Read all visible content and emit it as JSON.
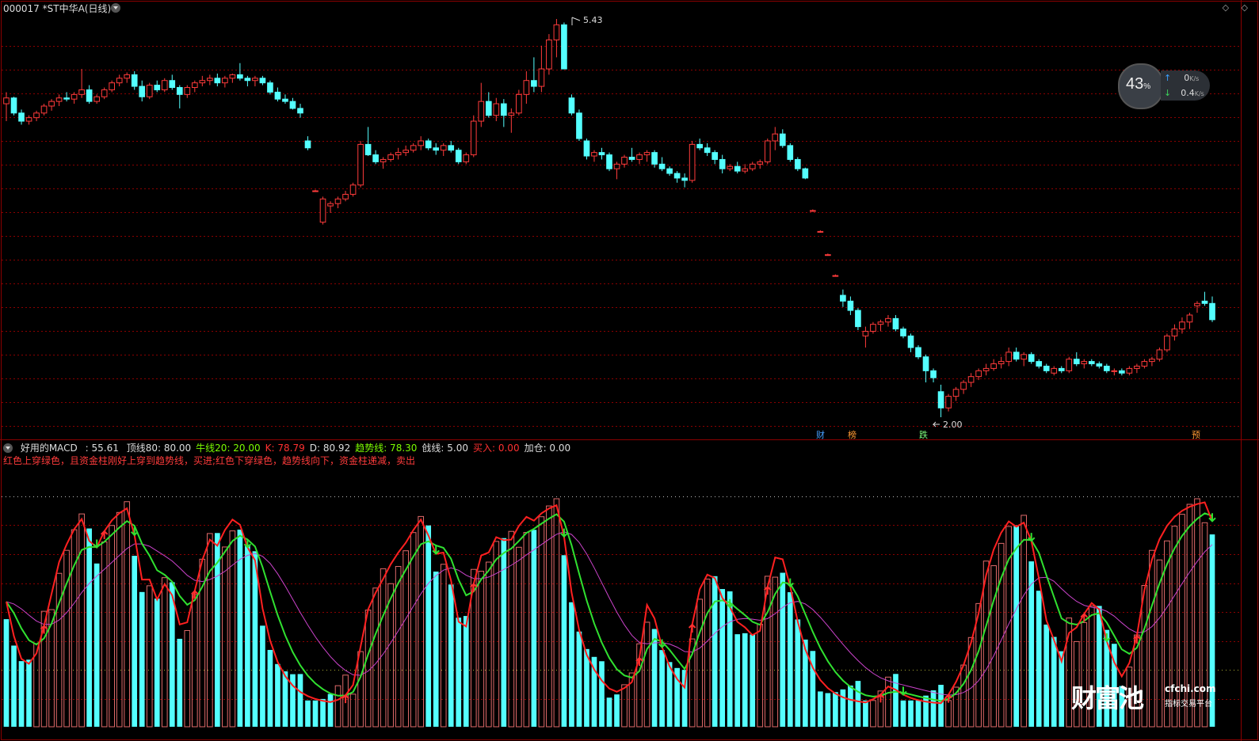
{
  "title": {
    "code_name": "000017 *ST中华A(日线)",
    "corner": "◇ ◇"
  },
  "price_labels": {
    "high": "5.43",
    "low": "2.00"
  },
  "event_marks": [
    {
      "label": "财",
      "color": "#46a0ff"
    },
    {
      "label": "榜",
      "color": "#ff9933"
    },
    {
      "label": "跌",
      "color": "#7cfc7c"
    },
    {
      "label": "预",
      "color": "#ff9933"
    }
  ],
  "indicator": {
    "name": "好用的MACD",
    "value": ": 55.61",
    "fields": [
      {
        "text": "顶线80: 80.00",
        "color": "#dddddd"
      },
      {
        "text": "牛线20: 20.00",
        "color": "#7cfc00"
      },
      {
        "text": "K: 78.79",
        "color": "#ff3030"
      },
      {
        "text": "D: 80.92",
        "color": "#dddddd"
      },
      {
        "text": "趋势线: 78.30",
        "color": "#7cfc00"
      },
      {
        "text": "戗线: 5.00",
        "color": "#dddddd"
      },
      {
        "text": "买入: 0.00",
        "color": "#ff3030"
      },
      {
        "text": "加仓: 0.00",
        "color": "#dddddd"
      }
    ],
    "description": "红色上穿绿色，且资金柱刚好上穿到趋势线，买进;红色下穿绿色，趋势线向下，资金柱递减，卖出"
  },
  "net_speed": {
    "percent": "43",
    "percent_unit": "%",
    "up_value": "0",
    "up_unit": "K/s",
    "down_value": "0.4",
    "down_unit": "K/s"
  },
  "watermark": {
    "cn": "财富池",
    "url": "cfchi.com",
    "sub": "指标交易平台"
  },
  "colors": {
    "up": "#ff3b3b",
    "down": "#54ffff",
    "grid": "#8b0000",
    "k_line": "#ff2020",
    "d_line": "#30e030",
    "trend": "#cc44cc"
  },
  "chart_data": {
    "type": "candlestick",
    "series_ohlc_note": "daily candles",
    "ylim": [
      2.0,
      5.43
    ],
    "candles": [
      [
        4.7,
        4.8,
        4.55,
        4.75
      ],
      [
        4.75,
        4.76,
        4.6,
        4.62
      ],
      [
        4.62,
        4.65,
        4.52,
        4.55
      ],
      [
        4.55,
        4.6,
        4.52,
        4.58
      ],
      [
        4.58,
        4.64,
        4.55,
        4.62
      ],
      [
        4.62,
        4.7,
        4.6,
        4.68
      ],
      [
        4.68,
        4.74,
        4.64,
        4.72
      ],
      [
        4.72,
        4.78,
        4.68,
        4.75
      ],
      [
        4.75,
        4.8,
        4.72,
        4.74
      ],
      [
        4.74,
        4.8,
        4.7,
        4.78
      ],
      [
        4.78,
        5.0,
        4.75,
        4.82
      ],
      [
        4.82,
        4.86,
        4.7,
        4.72
      ],
      [
        4.72,
        4.78,
        4.7,
        4.76
      ],
      [
        4.76,
        4.84,
        4.74,
        4.82
      ],
      [
        4.82,
        4.9,
        4.8,
        4.88
      ],
      [
        4.88,
        4.95,
        4.85,
        4.92
      ],
      [
        4.92,
        4.97,
        4.88,
        4.95
      ],
      [
        4.95,
        4.98,
        4.82,
        4.85
      ],
      [
        4.85,
        4.9,
        4.72,
        4.76
      ],
      [
        4.76,
        4.88,
        4.74,
        4.86
      ],
      [
        4.86,
        4.9,
        4.8,
        4.82
      ],
      [
        4.82,
        4.92,
        4.8,
        4.9
      ],
      [
        4.9,
        4.95,
        4.82,
        4.84
      ],
      [
        4.84,
        4.86,
        4.66,
        4.78
      ],
      [
        4.78,
        4.86,
        4.75,
        4.84
      ],
      [
        4.84,
        4.9,
        4.8,
        4.88
      ],
      [
        4.88,
        4.94,
        4.85,
        4.9
      ],
      [
        4.9,
        4.95,
        4.86,
        4.92
      ],
      [
        4.92,
        4.96,
        4.85,
        4.88
      ],
      [
        4.88,
        4.94,
        4.84,
        4.92
      ],
      [
        4.92,
        4.96,
        4.88,
        4.95
      ],
      [
        4.95,
        5.05,
        4.9,
        4.92
      ],
      [
        4.92,
        4.94,
        4.85,
        4.9
      ],
      [
        4.9,
        4.94,
        4.85,
        4.92
      ],
      [
        4.92,
        4.94,
        4.86,
        4.88
      ],
      [
        4.88,
        4.9,
        4.78,
        4.8
      ],
      [
        4.8,
        4.84,
        4.72,
        4.74
      ],
      [
        4.74,
        4.78,
        4.7,
        4.72
      ],
      [
        4.72,
        4.75,
        4.65,
        4.66
      ],
      [
        4.66,
        4.7,
        4.58,
        4.62
      ],
      [
        4.38,
        4.42,
        4.3,
        4.32
      ],
      [
        3.95,
        3.96,
        3.94,
        3.95
      ],
      [
        3.68,
        3.9,
        3.66,
        3.88
      ],
      [
        3.82,
        3.86,
        3.76,
        3.84
      ],
      [
        3.84,
        3.9,
        3.8,
        3.88
      ],
      [
        3.88,
        3.95,
        3.86,
        3.92
      ],
      [
        3.92,
        4.02,
        3.9,
        4.0
      ],
      [
        4.0,
        4.38,
        3.98,
        4.35
      ],
      [
        4.35,
        4.5,
        4.25,
        4.26
      ],
      [
        4.26,
        4.3,
        4.18,
        4.2
      ],
      [
        4.2,
        4.24,
        4.14,
        4.22
      ],
      [
        4.22,
        4.28,
        4.2,
        4.26
      ],
      [
        4.26,
        4.32,
        4.22,
        4.28
      ],
      [
        4.28,
        4.34,
        4.25,
        4.3
      ],
      [
        4.3,
        4.36,
        4.28,
        4.34
      ],
      [
        4.34,
        4.42,
        4.3,
        4.38
      ],
      [
        4.38,
        4.4,
        4.3,
        4.32
      ],
      [
        4.32,
        4.36,
        4.26,
        4.3
      ],
      [
        4.3,
        4.36,
        4.25,
        4.34
      ],
      [
        4.34,
        4.38,
        4.28,
        4.3
      ],
      [
        4.3,
        4.32,
        4.18,
        4.2
      ],
      [
        4.2,
        4.28,
        4.18,
        4.26
      ],
      [
        4.26,
        4.6,
        4.24,
        4.55
      ],
      [
        4.55,
        4.88,
        4.5,
        4.72
      ],
      [
        4.72,
        4.8,
        4.58,
        4.6
      ],
      [
        4.6,
        4.75,
        4.55,
        4.7
      ],
      [
        4.7,
        4.74,
        4.5,
        4.6
      ],
      [
        4.6,
        4.66,
        4.45,
        4.62
      ],
      [
        4.62,
        4.82,
        4.6,
        4.78
      ],
      [
        4.78,
        4.98,
        4.7,
        4.9
      ],
      [
        4.9,
        5.1,
        4.8,
        4.85
      ],
      [
        4.85,
        5.2,
        4.8,
        5.0
      ],
      [
        5.0,
        5.3,
        4.95,
        5.25
      ],
      [
        5.25,
        5.43,
        5.1,
        5.38
      ],
      [
        5.38,
        5.4,
        5.0,
        5.0
      ],
      [
        4.75,
        4.78,
        4.6,
        4.62
      ],
      [
        4.62,
        4.65,
        4.38,
        4.4
      ],
      [
        4.38,
        4.4,
        4.22,
        4.25
      ],
      [
        4.25,
        4.3,
        4.2,
        4.28
      ],
      [
        4.28,
        4.32,
        4.22,
        4.26
      ],
      [
        4.26,
        4.28,
        4.12,
        4.14
      ],
      [
        4.14,
        4.2,
        4.05,
        4.18
      ],
      [
        4.18,
        4.26,
        4.15,
        4.24
      ],
      [
        4.24,
        4.32,
        4.2,
        4.22
      ],
      [
        4.22,
        4.28,
        4.18,
        4.26
      ],
      [
        4.26,
        4.3,
        4.2,
        4.28
      ],
      [
        4.28,
        4.3,
        4.15,
        4.18
      ],
      [
        4.18,
        4.24,
        4.12,
        4.14
      ],
      [
        4.14,
        4.16,
        4.08,
        4.1
      ],
      [
        4.1,
        4.12,
        4.02,
        4.06
      ],
      [
        4.06,
        4.1,
        3.98,
        4.04
      ],
      [
        4.04,
        4.38,
        4.02,
        4.35
      ],
      [
        4.35,
        4.4,
        4.3,
        4.32
      ],
      [
        4.32,
        4.36,
        4.25,
        4.28
      ],
      [
        4.28,
        4.3,
        4.18,
        4.22
      ],
      [
        4.22,
        4.26,
        4.1,
        4.14
      ],
      [
        4.14,
        4.18,
        4.12,
        4.16
      ],
      [
        4.16,
        4.2,
        4.1,
        4.12
      ],
      [
        4.12,
        4.18,
        4.1,
        4.14
      ],
      [
        4.14,
        4.2,
        4.12,
        4.18
      ],
      [
        4.18,
        4.22,
        4.14,
        4.2
      ],
      [
        4.2,
        4.4,
        4.18,
        4.38
      ],
      [
        4.38,
        4.5,
        4.3,
        4.44
      ],
      [
        4.44,
        4.48,
        4.32,
        4.34
      ],
      [
        4.34,
        4.36,
        4.2,
        4.22
      ],
      [
        4.22,
        4.24,
        4.12,
        4.14
      ],
      [
        4.14,
        4.15,
        4.05,
        4.06
      ],
      [
        3.78,
        3.79,
        3.77,
        3.78
      ],
      [
        3.6,
        3.61,
        3.59,
        3.6
      ],
      [
        3.4,
        3.41,
        3.39,
        3.4
      ],
      [
        3.22,
        3.23,
        3.21,
        3.22
      ],
      [
        3.05,
        3.1,
        2.95,
        3.0
      ],
      [
        3.0,
        3.04,
        2.88,
        2.92
      ],
      [
        2.92,
        2.94,
        2.75,
        2.78
      ],
      [
        2.7,
        2.78,
        2.6,
        2.74
      ],
      [
        2.74,
        2.82,
        2.72,
        2.8
      ],
      [
        2.8,
        2.84,
        2.74,
        2.82
      ],
      [
        2.82,
        2.88,
        2.78,
        2.85
      ],
      [
        2.85,
        2.88,
        2.74,
        2.76
      ],
      [
        2.76,
        2.78,
        2.68,
        2.7
      ],
      [
        2.7,
        2.72,
        2.56,
        2.6
      ],
      [
        2.6,
        2.62,
        2.5,
        2.52
      ],
      [
        2.52,
        2.54,
        2.3,
        2.4
      ],
      [
        2.4,
        2.42,
        2.3,
        2.34
      ],
      [
        2.22,
        2.28,
        2.0,
        2.08
      ],
      [
        2.08,
        2.2,
        2.05,
        2.18
      ],
      [
        2.18,
        2.26,
        2.14,
        2.24
      ],
      [
        2.24,
        2.32,
        2.2,
        2.3
      ],
      [
        2.3,
        2.38,
        2.26,
        2.35
      ],
      [
        2.35,
        2.42,
        2.32,
        2.4
      ],
      [
        2.4,
        2.46,
        2.36,
        2.42
      ],
      [
        2.42,
        2.5,
        2.4,
        2.46
      ],
      [
        2.46,
        2.52,
        2.42,
        2.48
      ],
      [
        2.48,
        2.6,
        2.44,
        2.56
      ],
      [
        2.56,
        2.6,
        2.48,
        2.5
      ],
      [
        2.5,
        2.56,
        2.44,
        2.54
      ],
      [
        2.54,
        2.56,
        2.46,
        2.48
      ],
      [
        2.48,
        2.5,
        2.42,
        2.44
      ],
      [
        2.44,
        2.46,
        2.38,
        2.4
      ],
      [
        2.38,
        2.44,
        2.36,
        2.42
      ],
      [
        2.42,
        2.44,
        2.38,
        2.4
      ],
      [
        2.4,
        2.52,
        2.38,
        2.5
      ],
      [
        2.5,
        2.56,
        2.44,
        2.46
      ],
      [
        2.46,
        2.5,
        2.42,
        2.48
      ],
      [
        2.48,
        2.5,
        2.44,
        2.46
      ],
      [
        2.46,
        2.48,
        2.42,
        2.44
      ],
      [
        2.44,
        2.46,
        2.38,
        2.4
      ],
      [
        2.4,
        2.42,
        2.36,
        2.4
      ],
      [
        2.4,
        2.42,
        2.36,
        2.38
      ],
      [
        2.38,
        2.44,
        2.36,
        2.42
      ],
      [
        2.42,
        2.46,
        2.38,
        2.44
      ],
      [
        2.44,
        2.5,
        2.42,
        2.48
      ],
      [
        2.48,
        2.52,
        2.44,
        2.5
      ],
      [
        2.5,
        2.6,
        2.48,
        2.58
      ],
      [
        2.58,
        2.72,
        2.56,
        2.7
      ],
      [
        2.7,
        2.8,
        2.66,
        2.76
      ],
      [
        2.76,
        2.86,
        2.72,
        2.82
      ],
      [
        2.82,
        2.9,
        2.76,
        2.88
      ],
      [
        2.96,
        3.0,
        2.9,
        2.98
      ],
      [
        3.0,
        3.08,
        2.96,
        2.98
      ],
      [
        2.98,
        3.04,
        2.82,
        2.84
      ]
    ]
  }
}
